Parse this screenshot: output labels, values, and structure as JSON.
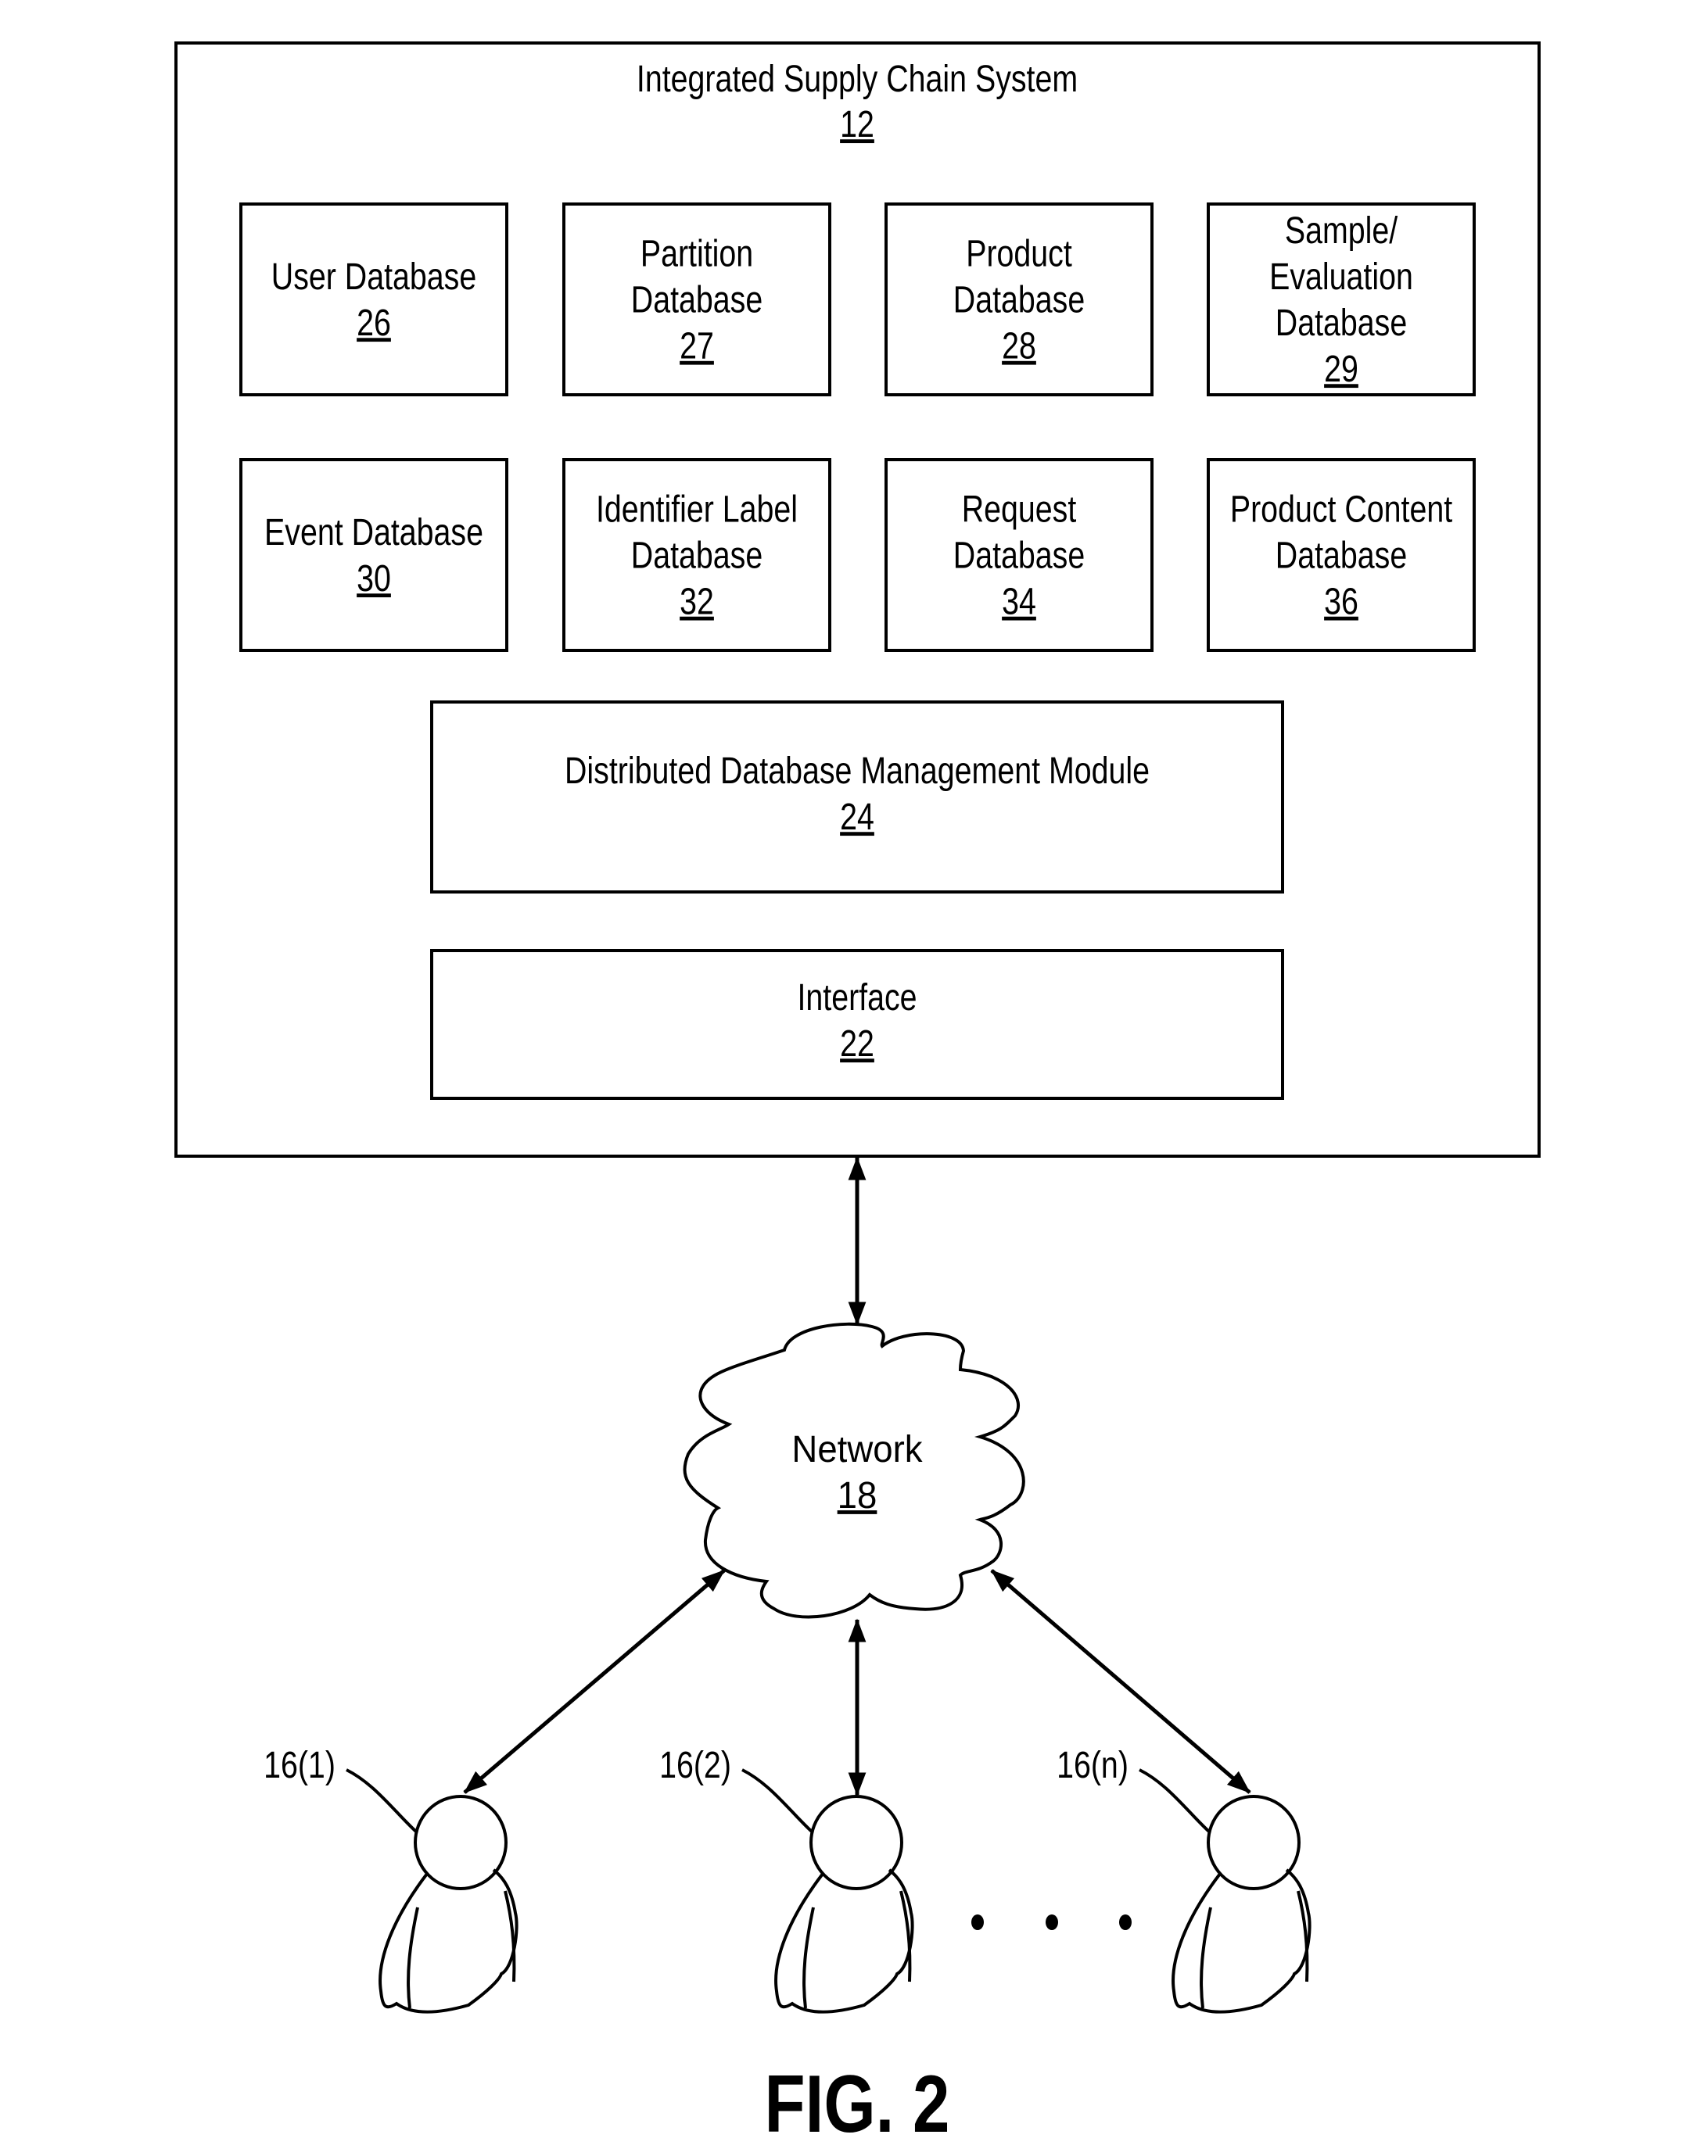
{
  "figure_label": "FIG. 2",
  "system": {
    "title": "Integrated Supply Chain System",
    "ref": "12"
  },
  "databases": [
    {
      "lines": [
        "User Database"
      ],
      "ref": "26"
    },
    {
      "lines": [
        "Partition",
        "Database"
      ],
      "ref": "27"
    },
    {
      "lines": [
        "Product",
        "Database"
      ],
      "ref": "28"
    },
    {
      "lines": [
        "Sample/",
        "Evaluation",
        "Database"
      ],
      "ref": "29"
    },
    {
      "lines": [
        "Event Database"
      ],
      "ref": "30"
    },
    {
      "lines": [
        "Identifier Label",
        "Database"
      ],
      "ref": "32"
    },
    {
      "lines": [
        "Request",
        "Database"
      ],
      "ref": "34"
    },
    {
      "lines": [
        "Product Content",
        "Database"
      ],
      "ref": "36"
    }
  ],
  "management_module": {
    "title": "Distributed Database Management Module",
    "ref": "24"
  },
  "interface": {
    "title": "Interface",
    "ref": "22"
  },
  "network": {
    "title": "Network",
    "ref": "18"
  },
  "users": [
    {
      "label": "16(1)"
    },
    {
      "label": "16(2)"
    },
    {
      "label": "16(n)"
    }
  ],
  "ellipsis_dots": 3
}
